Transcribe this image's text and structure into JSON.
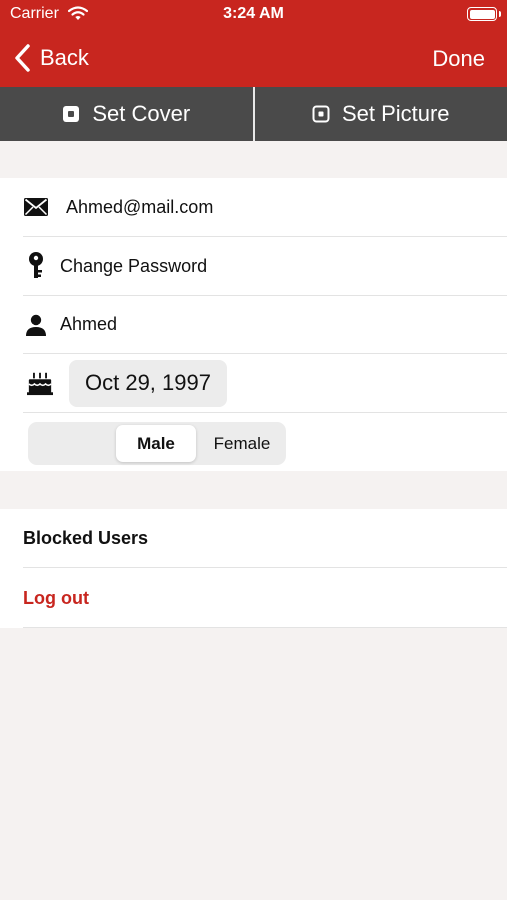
{
  "status_bar": {
    "carrier": "Carrier",
    "time": "3:24 AM"
  },
  "nav": {
    "back_label": "Back",
    "done_label": "Done"
  },
  "photo_actions": {
    "set_cover": "Set Cover",
    "set_picture": "Set Picture"
  },
  "profile": {
    "email": "Ahmed@mail.com",
    "change_password": "Change Password",
    "name": "Ahmed",
    "birthdate": "Oct 29, 1997",
    "gender": {
      "options": [
        "Male",
        "Female"
      ],
      "selected": "Male"
    }
  },
  "account": {
    "blocked_users": "Blocked Users",
    "log_out": "Log out"
  },
  "colors": {
    "brand_red": "#c8261f",
    "photo_bar": "#4a4a4a",
    "background": "#f5f2f1"
  },
  "icons": [
    "chevron-left-icon",
    "wifi-icon",
    "battery-icon",
    "picture-icon",
    "envelope-icon",
    "key-icon",
    "person-icon",
    "cake-icon"
  ]
}
